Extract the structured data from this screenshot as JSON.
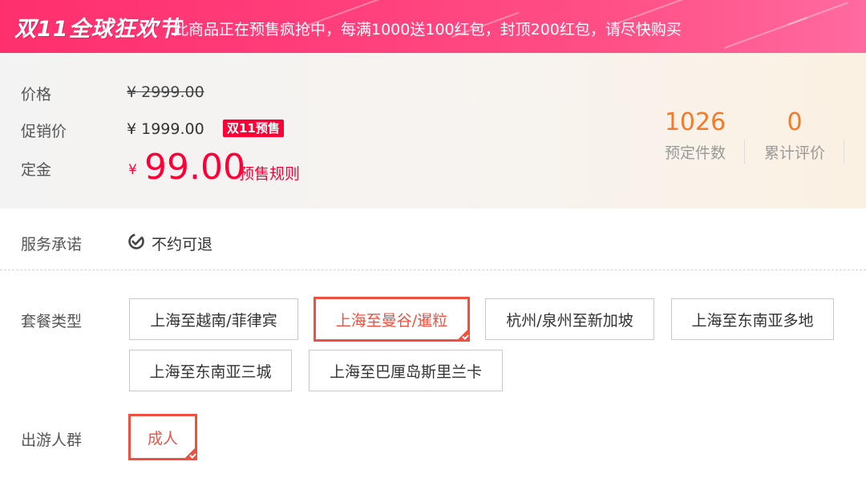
{
  "banner": {
    "brand": "双11全球狂欢节",
    "notice": "此商品正在预售疯抢中，每满1000送100红包，封顶200红包，请尽快购买"
  },
  "price": {
    "label_price": "价格",
    "original": "¥ 2999.00",
    "label_promo": "促销价",
    "promo": "¥ 1999.00",
    "promo_badge": "双11预售",
    "label_deposit": "定金",
    "deposit_currency": "¥",
    "deposit_amount": "99.00",
    "presale_rule": "预售规则"
  },
  "stats": [
    {
      "value": "1026",
      "caption": "预定件数"
    },
    {
      "value": "0",
      "caption": "累计评价"
    }
  ],
  "service": {
    "label": "服务承诺",
    "item": "不约可退"
  },
  "package": {
    "label": "套餐类型",
    "options": [
      "上海至越南/菲律宾",
      "上海至曼谷/暹粒",
      "杭州/泉州至新加坡",
      "上海至东南亚多地",
      "上海至东南亚三城",
      "上海至巴厘岛斯里兰卡"
    ],
    "selected": "上海至曼谷/暹粒"
  },
  "travelers": {
    "label": "出游人群",
    "options": [
      "成人"
    ],
    "selected": "成人"
  },
  "colors": {
    "accent": "#ff0036",
    "selected_border": "#f0503f",
    "stat_number": "#f27a2a"
  }
}
